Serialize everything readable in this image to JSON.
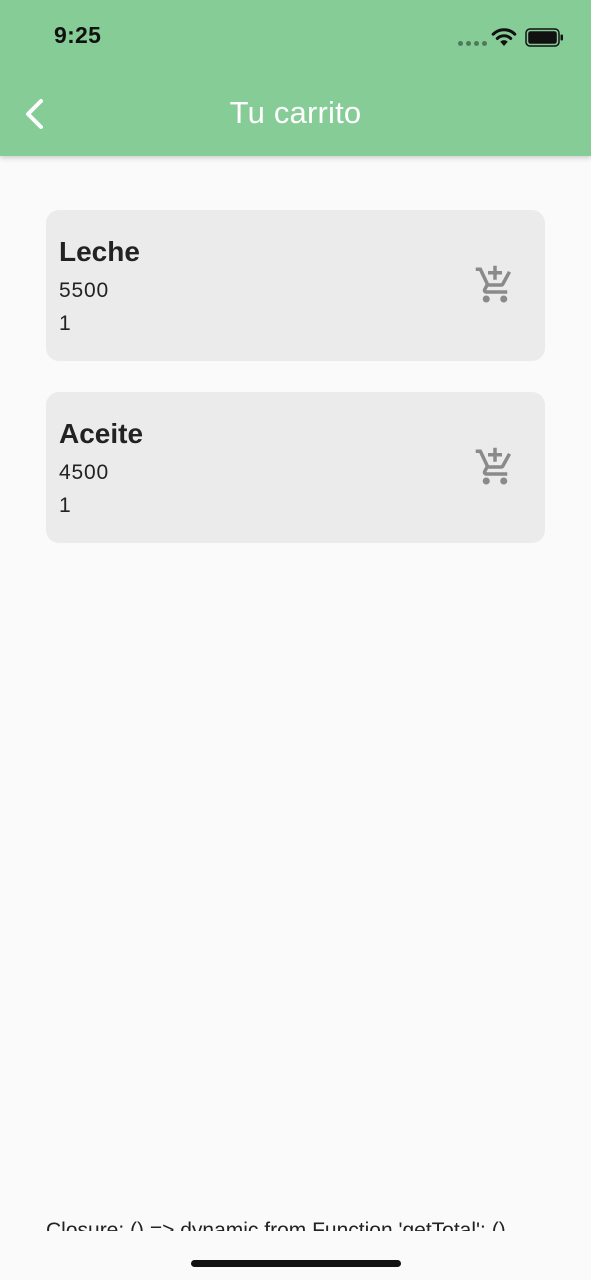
{
  "status_bar": {
    "time": "9:25",
    "icons": [
      "cellular-dots-icon",
      "wifi-icon",
      "battery-icon"
    ]
  },
  "header": {
    "title": "Tu carrito",
    "back_icon": "chevron-left-icon"
  },
  "cart": {
    "items": [
      {
        "name": "Leche",
        "price": "5500",
        "quantity": "1",
        "action_icon": "add-shopping-cart-icon"
      },
      {
        "name": "Aceite",
        "price": "4500",
        "quantity": "1",
        "action_icon": "add-shopping-cart-icon"
      }
    ]
  },
  "footer": {
    "text": "Closure: () => dynamic from Function 'getTotal': ()"
  },
  "colors": {
    "appbar": "#86cc97",
    "card": "#ebebeb",
    "background": "#fafafa",
    "icon": "#8a8a8a"
  }
}
